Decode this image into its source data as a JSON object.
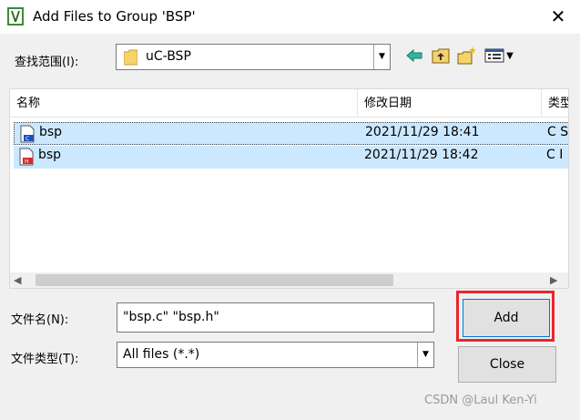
{
  "window": {
    "title": "Add Files to Group 'BSP'",
    "close_glyph": "✕"
  },
  "look_in": {
    "label": "查找范围(I):",
    "value": "uC-BSP"
  },
  "file_list": {
    "columns": [
      "名称",
      "修改日期",
      "类型"
    ],
    "rows": [
      {
        "name": "bsp",
        "date": "2021/11/29 18:41",
        "type": "C S",
        "icon": "c-source-file-icon"
      },
      {
        "name": "bsp",
        "date": "2021/11/29 18:42",
        "type": "C I",
        "icon": "c-header-file-icon"
      }
    ]
  },
  "file_name": {
    "label": "文件名(N):",
    "value": "\"bsp.c\" \"bsp.h\""
  },
  "file_type": {
    "label": "文件类型(T):",
    "value": "All files (*.*)"
  },
  "buttons": {
    "add": "Add",
    "close": "Close"
  },
  "colors": {
    "selection": "#cce8ff",
    "highlight": "#e8262b",
    "default_button_border": "#0078d7"
  },
  "watermark": "CSDN @Laul Ken-Yi"
}
